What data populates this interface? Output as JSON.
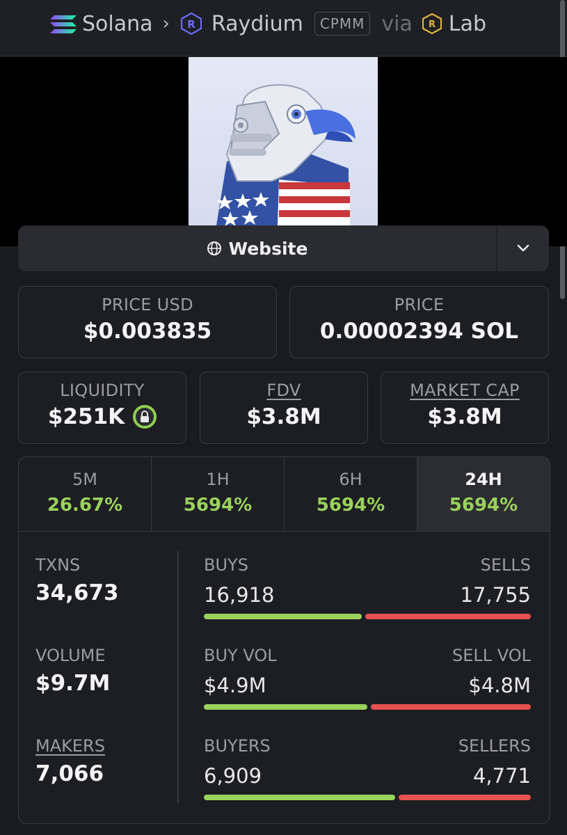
{
  "header": {
    "chain": "Solana",
    "dex": "Raydium",
    "pool_type": "CPMM",
    "via_label": "via",
    "launchpad": "Lab",
    "chain_icon": "solana-logo-icon",
    "dex_icon": "raydium-logo-icon",
    "launchpad_icon": "lab-logo-icon"
  },
  "banner": {
    "image": "robot-eagle-american-flag"
  },
  "links": {
    "website_label": "Website"
  },
  "prices": {
    "price_usd_label": "PRICE USD",
    "price_usd": "$0.003835",
    "price_native_label": "PRICE",
    "price_native": "0.00002394 SOL"
  },
  "metrics": {
    "liquidity_label": "LIQUIDITY",
    "liquidity": "$251K",
    "fdv_label": "FDV",
    "fdv": "$3.8M",
    "mcap_label": "MARKET CAP",
    "mcap": "$3.8M"
  },
  "tabs": [
    {
      "label": "5M",
      "change": "26.67%"
    },
    {
      "label": "1H",
      "change": "5694%"
    },
    {
      "label": "6H",
      "change": "5694%"
    },
    {
      "label": "24H",
      "change": "5694%"
    }
  ],
  "active_tab": "24H",
  "txns": {
    "label": "TXNS",
    "value": "34,673",
    "buys_label": "BUYS",
    "buys": "16,918",
    "sells_label": "SELLS",
    "sells": "17,755",
    "buy_share": 0.488
  },
  "volume": {
    "label": "VOLUME",
    "value": "$9.7M",
    "buy_label": "BUY VOL",
    "buy": "$4.9M",
    "sell_label": "SELL VOL",
    "sell": "$4.8M",
    "buy_share": 0.505
  },
  "makers": {
    "label": "MAKERS",
    "value": "7,066",
    "buyers_label": "BUYERS",
    "buyers": "6,909",
    "sellers_label": "SELLERS",
    "sellers": "4,771",
    "buy_share": 0.592
  },
  "colors": {
    "positive": "#9bd25c",
    "negative": "#e5524f",
    "background": "#1a1b20"
  }
}
